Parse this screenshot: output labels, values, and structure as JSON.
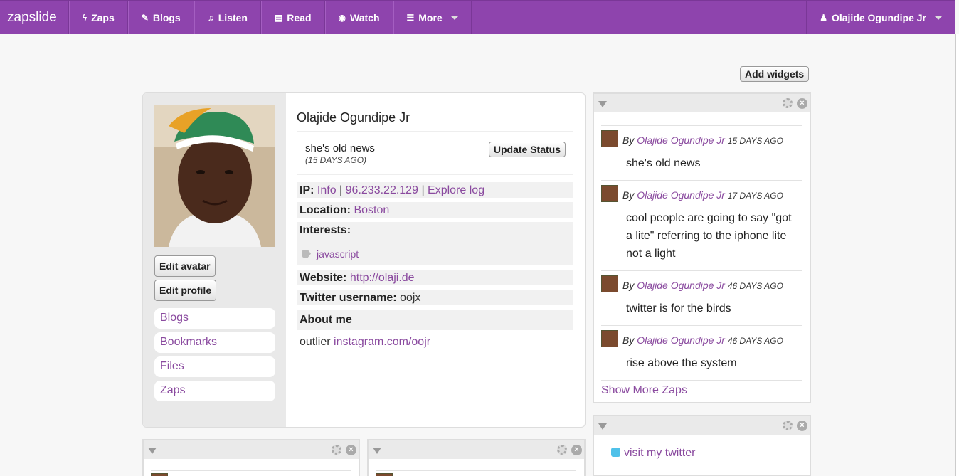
{
  "nav": {
    "brand": "zapslide",
    "items": [
      {
        "icon": "bolt-icon",
        "glyph": "ϟ",
        "label": "Zaps"
      },
      {
        "icon": "pencil-icon",
        "glyph": "✎",
        "label": "Blogs"
      },
      {
        "icon": "music-icon",
        "glyph": "♫",
        "label": "Listen"
      },
      {
        "icon": "book-icon",
        "glyph": "▤",
        "label": "Read"
      },
      {
        "icon": "eye-icon",
        "glyph": "◉",
        "label": "Watch"
      },
      {
        "icon": "menu-icon",
        "glyph": "☰",
        "label": "More"
      }
    ],
    "user": "Olajide Ogundipe Jr",
    "user_glyph": "♟"
  },
  "add_widgets": "Add widgets",
  "profile": {
    "name": "Olajide Ogundipe Jr",
    "status": "she's old news",
    "status_ago": "(15 DAYS AGO)",
    "update_btn": "Update Status",
    "edit_avatar": "Edit avatar",
    "edit_profile": "Edit profile",
    "links": [
      "Blogs",
      "Bookmarks",
      "Files",
      "Zaps"
    ],
    "ip_label": "IP:",
    "ip_info": "Info",
    "ip_sep": "|",
    "ip_addr": "96.233.22.129",
    "ip_log": "Explore log",
    "location_label": "Location:",
    "location": "Boston",
    "interests_label": "Interests:",
    "interest_tag": "javascript",
    "website_label": "Website:",
    "website": "http://olaji.de",
    "twitter_label": "Twitter username:",
    "twitter": "oojx",
    "about_label": "About me",
    "about_text": "outlier",
    "about_link": "instagram.com/oojr"
  },
  "zaps": {
    "by": "By",
    "author": "Olajide Ogundipe Jr",
    "items": [
      {
        "ago": "15 DAYS AGO",
        "text": "she's old news"
      },
      {
        "ago": "17 DAYS AGO",
        "text": "cool people are going to say \"got a lite\" referring to the iphone lite not a light"
      },
      {
        "ago": "46 DAYS AGO",
        "text": "twitter is for the birds"
      },
      {
        "ago": "46 DAYS AGO",
        "text": "rise above the system"
      }
    ],
    "show_more": "Show More Zaps"
  },
  "twitter_widget": {
    "link": "visit my twitter"
  },
  "colors": {
    "brand": "#8e44ad",
    "link": "#8a4a9f"
  }
}
